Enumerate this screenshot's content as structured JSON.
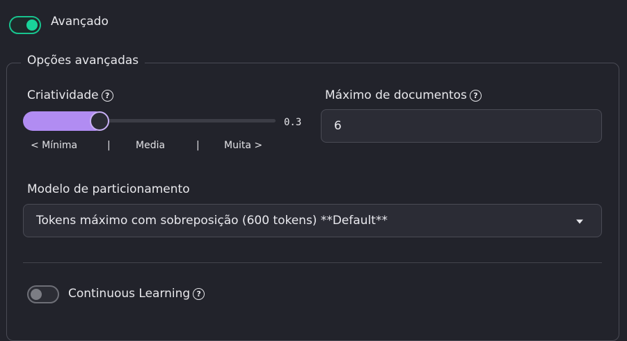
{
  "advanced_toggle": {
    "label": "Avançado",
    "state": "on"
  },
  "advanced_options": {
    "legend": "Opções avançadas",
    "creativity": {
      "label": "Criatividade",
      "value": 0.3,
      "value_text": "0.3",
      "scale": {
        "min": "< Mínima",
        "sep": "|",
        "mid": "Media",
        "max": "Muita >"
      }
    },
    "max_documents": {
      "label": "Máximo de documentos",
      "value": "6"
    },
    "chunking_model": {
      "label": "Modelo de particionamento",
      "selected": "Tokens máximo com sobreposição (600 tokens) **Default**"
    },
    "continuous_learning": {
      "label": "Continuous Learning",
      "state": "off"
    },
    "help_icon_glyph": "?"
  },
  "colors": {
    "accent_green": "#19d49a",
    "slider_purple": "#b18cf2",
    "background": "#22232b"
  }
}
